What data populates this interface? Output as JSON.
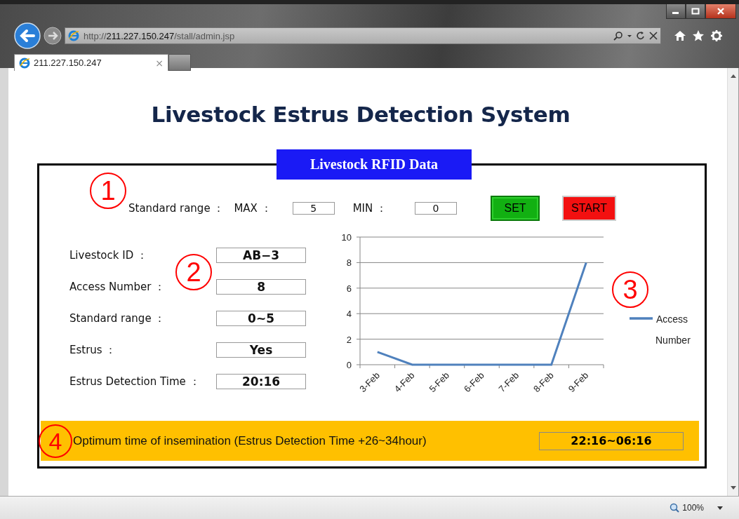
{
  "browser": {
    "url": [
      {
        "text": "http://",
        "strong": false
      },
      {
        "text": "211.227.150.247",
        "strong": true
      },
      {
        "text": "/stall/admin.jsp",
        "strong": false
      }
    ],
    "tab": {
      "title": "211.227.150.247",
      "close": "×"
    },
    "zoom": "100%"
  },
  "page": {
    "title": "Livestock Estrus Detection System",
    "panel_title": "Livestock RFID Data",
    "markers": [
      "1",
      "2",
      "3",
      "4"
    ],
    "range": {
      "label": "Standard range ：",
      "max_label": "MAX ：",
      "max": "5",
      "min_label": "MIN ：",
      "min": "0"
    },
    "buttons": [
      {
        "label": "SET",
        "kind": "set"
      },
      {
        "label": "START",
        "kind": "start"
      }
    ],
    "fields": [
      {
        "label": "Livestock ID ：",
        "value": "AB−3"
      },
      {
        "label": "Access Number ：",
        "value": "8"
      },
      {
        "label": "Standard range ：",
        "value": "0~5"
      },
      {
        "label": "Estrus ：",
        "value": "Yes"
      },
      {
        "label": "Estrus Detection Time ：",
        "value": "20:16"
      }
    ],
    "chart_data": {
      "type": "line",
      "categories": [
        "3-Feb",
        "4-Feb",
        "5-Feb",
        "6-Feb",
        "7-Feb",
        "8-Feb",
        "9-Feb"
      ],
      "series": [
        {
          "name": "Access Number",
          "color": "#4f81bd",
          "values": [
            1,
            0,
            0,
            0,
            0,
            0,
            8
          ]
        }
      ],
      "ylim": [
        0,
        10
      ],
      "yticks": [
        0,
        2,
        4,
        6,
        8,
        10
      ],
      "grid": true
    },
    "insemination": {
      "text": "Optimum time of insemination (Estrus Detection Time +26~34hour)",
      "value": "22:16~06:16"
    }
  }
}
